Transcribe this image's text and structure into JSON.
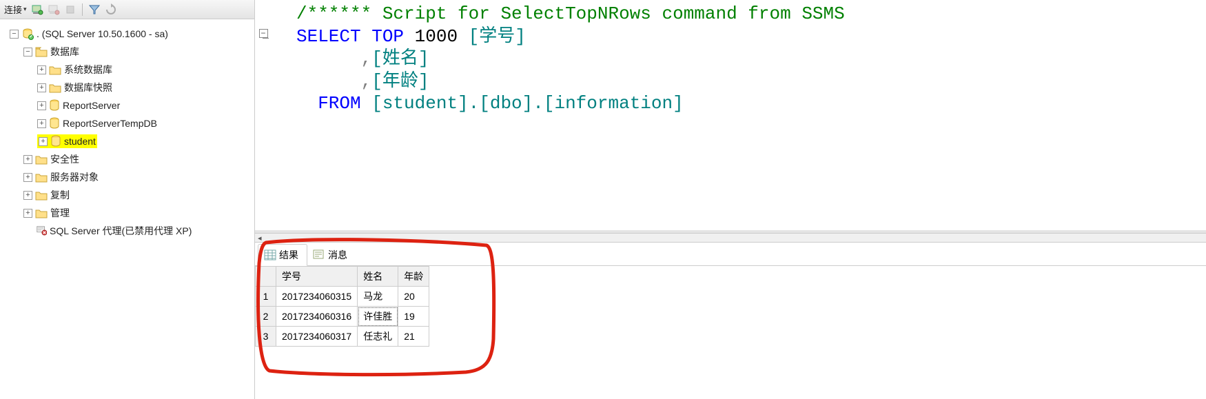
{
  "toolbar": {
    "connect_label": "连接"
  },
  "tree": {
    "server_label": ". (SQL Server 10.50.1600 - sa)",
    "databases_label": "数据库",
    "system_db_label": "系统数据库",
    "db_snapshots_label": "数据库快照",
    "report_server_label": "ReportServer",
    "report_server_temp_label": "ReportServerTempDB",
    "student_label": "student",
    "security_label": "安全性",
    "server_objects_label": "服务器对象",
    "replication_label": "复制",
    "management_label": "管理",
    "agent_label": "SQL Server 代理(已禁用代理 XP)"
  },
  "sql": {
    "comment": "/****** Script for SelectTopNRows command from SSMS",
    "select": "SELECT",
    "top": " TOP",
    "topn": " 1000 ",
    "col1": "[学号]",
    "comma1": "      ,",
    "col2": "[姓名]",
    "comma2": "      ,",
    "col3": "[年龄]",
    "from": "  FROM",
    "tbl": " [student].[dbo].[information]"
  },
  "results": {
    "tab_results": "结果",
    "tab_messages": "消息",
    "headers": {
      "c0": "",
      "c1": "学号",
      "c2": "姓名",
      "c3": "年龄"
    },
    "rows": [
      {
        "idx": "1",
        "c1": "2017234060315",
        "c2": "马龙",
        "c3": "20"
      },
      {
        "idx": "2",
        "c1": "2017234060316",
        "c2": "许佳胜",
        "c3": "19"
      },
      {
        "idx": "3",
        "c1": "2017234060317",
        "c2": "任志礼",
        "c3": "21"
      }
    ]
  }
}
